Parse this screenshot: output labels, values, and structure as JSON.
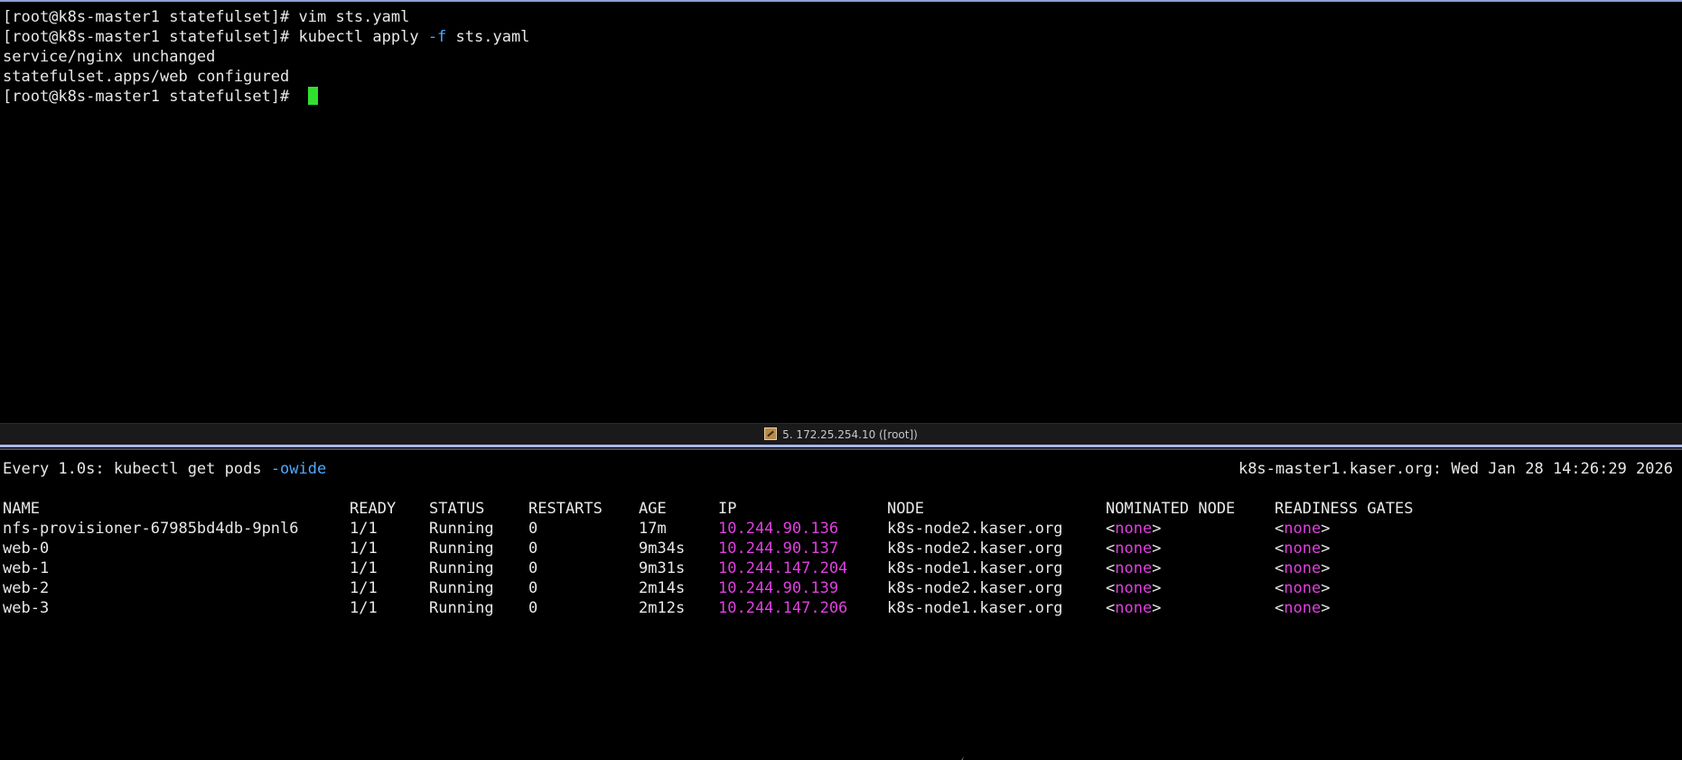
{
  "top_pane": {
    "lines": [
      {
        "prompt": "[root@k8s-master1 statefulset]# ",
        "command": "vim sts.yaml"
      },
      {
        "prompt": "[root@k8s-master1 statefulset]# ",
        "command_before_flag": "kubectl apply ",
        "flag": "-f",
        "command_after_flag": " sts.yaml"
      },
      {
        "output": "service/nginx unchanged"
      },
      {
        "output": "statefulset.apps/web configured"
      },
      {
        "prompt": "[root@k8s-master1 statefulset]# "
      }
    ]
  },
  "tab_bar": {
    "icon": "pencil-session-icon",
    "label": "5. 172.25.254.10 ([root])"
  },
  "bottom_pane": {
    "watch_header": {
      "every": "Every 1.0s: kubectl get pods ",
      "flag": "-owide",
      "host_time": "k8s-master1.kaser.org: Wed Jan 28 14:26:29 2026"
    },
    "columns": [
      "NAME",
      "READY",
      "STATUS",
      "RESTARTS",
      "AGE",
      "IP",
      "NODE",
      "NOMINATED NODE",
      "READINESS GATES"
    ],
    "rows": [
      {
        "name": "nfs-provisioner-67985bd4db-9pnl6",
        "ready": "1/1",
        "status": "Running",
        "restarts": "0",
        "age": "17m",
        "ip": "10.244.90.136",
        "node": "k8s-node2.kaser.org",
        "nominated": "none",
        "gates": "none"
      },
      {
        "name": "web-0",
        "ready": "1/1",
        "status": "Running",
        "restarts": "0",
        "age": "9m34s",
        "ip": "10.244.90.137",
        "node": "k8s-node2.kaser.org",
        "nominated": "none",
        "gates": "none"
      },
      {
        "name": "web-1",
        "ready": "1/1",
        "status": "Running",
        "restarts": "0",
        "age": "9m31s",
        "ip": "10.244.147.204",
        "node": "k8s-node1.kaser.org",
        "nominated": "none",
        "gates": "none"
      },
      {
        "name": "web-2",
        "ready": "1/1",
        "status": "Running",
        "restarts": "0",
        "age": "2m14s",
        "ip": "10.244.90.139",
        "node": "k8s-node2.kaser.org",
        "nominated": "none",
        "gates": "none"
      },
      {
        "name": "web-3",
        "ready": "1/1",
        "status": "Running",
        "restarts": "0",
        "age": "2m12s",
        "ip": "10.244.147.206",
        "node": "k8s-node1.kaser.org",
        "nominated": "none",
        "gates": "none"
      }
    ]
  },
  "colors": {
    "background": "#000000",
    "text": "#e8e8e8",
    "flag": "#4fa8ff",
    "ip": "#e040e0",
    "cursor": "#2fe02f"
  }
}
